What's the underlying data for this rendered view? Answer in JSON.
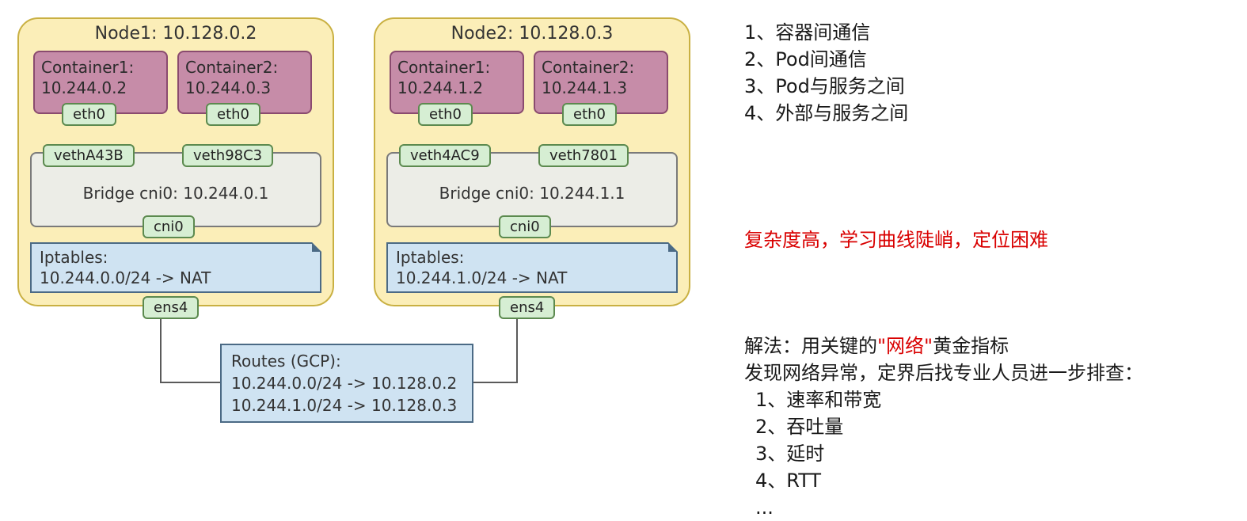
{
  "diagram": {
    "nodes": [
      {
        "title": "Node1: 10.128.0.2",
        "containers": [
          {
            "label": "Container1: 10.244.0.2",
            "eth": "eth0"
          },
          {
            "label": "Container2: 10.244.0.3",
            "eth": "eth0"
          }
        ],
        "bridge": {
          "veth_left": "vethA43B",
          "veth_right": "veth98C3",
          "title": "Bridge cni0: 10.244.0.1",
          "port": "cni0"
        },
        "iptables": {
          "header": "Iptables:",
          "rule": "10.244.0.0/24 -> NAT"
        },
        "ext_port": "ens4"
      },
      {
        "title": "Node2: 10.128.0.3",
        "containers": [
          {
            "label": "Container1: 10.244.1.2",
            "eth": "eth0"
          },
          {
            "label": "Container2: 10.244.1.3",
            "eth": "eth0"
          }
        ],
        "bridge": {
          "veth_left": "veth4AC9",
          "veth_right": "veth7801",
          "title": "Bridge cni0: 10.244.1.1",
          "port": "cni0"
        },
        "iptables": {
          "header": "Iptables:",
          "rule": "10.244.1.0/24 -> NAT"
        },
        "ext_port": "ens4"
      }
    ],
    "routes": {
      "header": "Routes (GCP):",
      "r1": "10.244.0.0/24 -> 10.128.0.2",
      "r2": "10.244.1.0/24 -> 10.128.0.3"
    }
  },
  "sidebar": {
    "topics": [
      "1、容器间通信",
      "2、Pod间通信",
      "3、Pod与服务之间",
      "4、外部与服务之间"
    ],
    "warning": "复杂度高，学习曲线陡峭，定位困难",
    "solution": {
      "prefix": "解法：用关键的",
      "quoted": "\"网络\"",
      "suffix": "黄金指标",
      "line2": "发现网络异常，定界后找专业人员进一步排查：",
      "metrics": [
        "1、速率和带宽",
        "2、吞吐量",
        "3、延时",
        "4、RTT",
        "..."
      ]
    }
  }
}
